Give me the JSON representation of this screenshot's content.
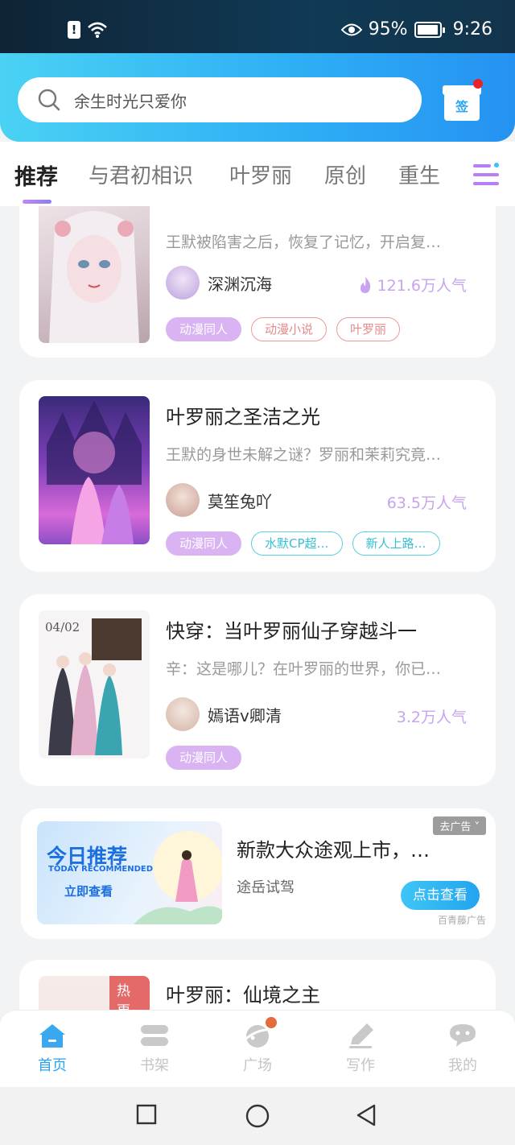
{
  "status_bar": {
    "battery": "95%",
    "time": "9:26"
  },
  "header": {
    "search_placeholder": "余生时光只爱你",
    "signin_label": "签"
  },
  "tabs": [
    {
      "label": "推荐",
      "active": true
    },
    {
      "label": "与君初相识",
      "active": false
    },
    {
      "label": "叶罗丽",
      "active": false
    },
    {
      "label": "原创",
      "active": false
    },
    {
      "label": "重生",
      "active": false
    }
  ],
  "books": [
    {
      "title": "",
      "desc": "王默被陷害之后，恢复了记忆，开启复…",
      "author": "深渊沉海",
      "popularity": "121.6万人气",
      "tags": [
        {
          "label": "动漫同人",
          "style": "purple"
        },
        {
          "label": "动漫小说",
          "style": "red"
        },
        {
          "label": "叶罗丽",
          "style": "red"
        }
      ]
    },
    {
      "title": "叶罗丽之圣洁之光",
      "desc": "王默的身世未解之谜？罗丽和茉莉究竟…",
      "author": "莫笙兔吖",
      "popularity": "63.5万人气",
      "tags": [
        {
          "label": "动漫同人",
          "style": "purple"
        },
        {
          "label": "水默CP超…",
          "style": "cyan"
        },
        {
          "label": "新人上路…",
          "style": "cyan"
        }
      ]
    },
    {
      "title": "快穿：当叶罗丽仙子穿越斗一",
      "desc": "辛：这是哪儿？在叶罗丽的世界，你已…",
      "author": "嫣语v卿清",
      "popularity": "3.2万人气",
      "cover_text": "04/02",
      "tags": [
        {
          "label": "动漫同人",
          "style": "purple"
        }
      ]
    }
  ],
  "ad": {
    "image_title": "今日推荐",
    "image_subtitle": "TODAY RECOMMENDED",
    "image_button": "立即查看",
    "title": "新款大众途观上市，…",
    "subtitle": "途岳试驾",
    "close_label": "去广告 ˅",
    "cta": "点击查看",
    "source": "百青藤广告"
  },
  "partial_book": {
    "badge": "热更",
    "title": "叶罗丽：仙境之主"
  },
  "bottom_nav": [
    {
      "label": "首页",
      "icon": "home-icon",
      "active": true
    },
    {
      "label": "书架",
      "icon": "bookshelf-icon",
      "active": false
    },
    {
      "label": "广场",
      "icon": "planet-icon",
      "active": false
    },
    {
      "label": "写作",
      "icon": "pen-icon",
      "active": false
    },
    {
      "label": "我的",
      "icon": "profile-icon",
      "active": false
    }
  ],
  "colors": {
    "accent": "#2aa2ef",
    "tab_indicator": "#b87ef5",
    "popularity": "#c7a4ec"
  }
}
